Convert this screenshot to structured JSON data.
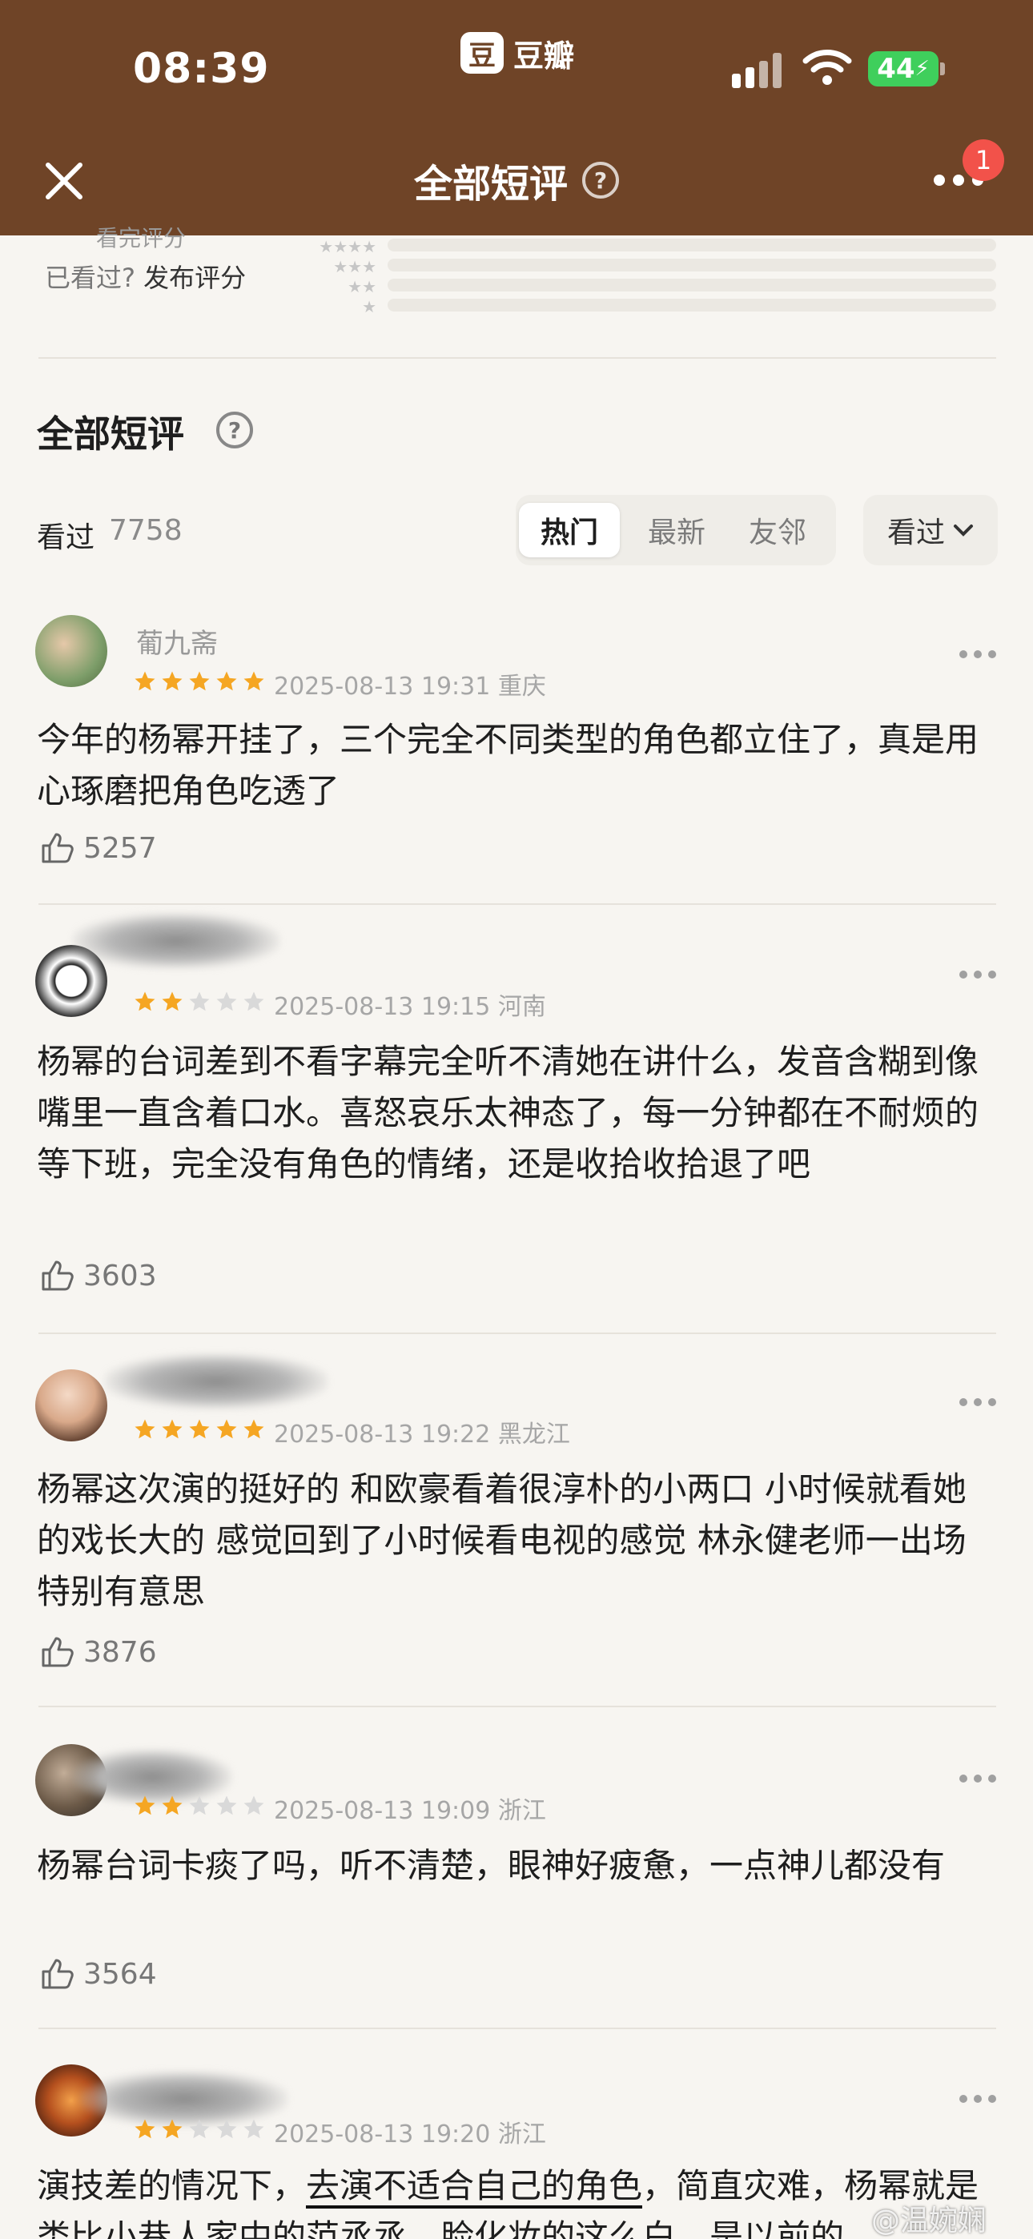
{
  "status_bar": {
    "time": "08:39",
    "app_badge_text": "豆瓣",
    "app_badge_glyph": "豆",
    "battery": "44"
  },
  "header": {
    "title": "全部短评",
    "notification_count": "1"
  },
  "rating_summary": {
    "partial_label": "看完评分",
    "prompt": "已看过?",
    "action": "发布评分"
  },
  "section": {
    "title": "全部短评",
    "seen_label": "看过",
    "seen_count": "7758",
    "tabs": [
      "热门",
      "最新",
      "友邻"
    ],
    "active_tab": "热门",
    "filter_label": "看过"
  },
  "reviews": [
    {
      "username": "葡九斋",
      "stars": 5,
      "date": "2025-08-13 19:31",
      "location": "重庆",
      "text": "今年的杨幂开挂了，三个完全不同类型的角色都立住了，真是用心琢磨把角色吃透了",
      "likes": "5257"
    },
    {
      "username": "",
      "stars": 2,
      "date": "2025-08-13 19:15",
      "location": "河南",
      "text": "杨幂的台词差到不看字幕完全听不清她在讲什么，发音含糊到像嘴里一直含着口水。喜怒哀乐太神态了，每一分钟都在不耐烦的等下班，完全没有角色的情绪，还是收拾收拾退了吧",
      "likes": "3603"
    },
    {
      "username": "",
      "stars": 5,
      "date": "2025-08-13 19:22",
      "location": "黑龙江",
      "text": "杨幂这次演的挺好的 和欧豪看着很淳朴的小两口 小时候就看她的戏长大的 感觉回到了小时候看电视的感觉 林永健老师一出场特别有意思",
      "likes": "3876"
    },
    {
      "username": "",
      "stars": 2,
      "date": "2025-08-13 19:09",
      "location": "浙江",
      "text": "杨幂台词卡痰了吗，听不清楚，眼神好疲惫，一点神儿都没有",
      "likes": "3564"
    },
    {
      "username": "",
      "stars": 2,
      "date": "2025-08-13 19:20",
      "location": "浙江",
      "text_a": "演技差的情况下，",
      "text_underlined": "去演不适合自己的角色",
      "text_b": "，简直灾难，杨幂就是类比小巷人家中的范丞丞，脸化妆的这么白，是以前的"
    }
  ],
  "watermark": "@温婉娴",
  "colors": {
    "header_bg": "#6f4427",
    "star_active": "#f5a623",
    "star_inactive": "#d9d9d9",
    "badge": "#f2524a",
    "battery": "#3fcf5c"
  }
}
